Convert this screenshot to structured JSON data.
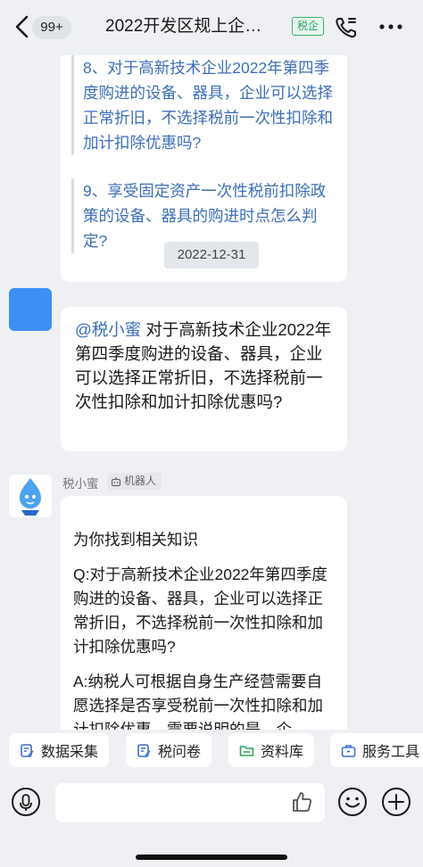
{
  "header": {
    "unread_badge": "99+",
    "title": "2022开发区规上企…",
    "tag": "税企"
  },
  "messages": {
    "card_questions": [
      "8、对于高新技术企业2022年第四季度购进的设备、器具，企业可以选择正常折旧，不选择税前一次性扣除和加计扣除优惠吗?",
      "9、享受固定资产一次性税前扣除政策的设备、器具的购进时点怎么判定?"
    ],
    "date_divider": "2022-12-31",
    "user_message": {
      "mention": "@税小蜜",
      "text": " 对于高新技术企业2022年第四季度购进的设备、器具，企业可以选择正常折旧，不选择税前一次性扣除和加计扣除优惠吗?"
    },
    "bot": {
      "name": "税小蜜",
      "robot_label": "机器人",
      "intro": "为你找到相关知识",
      "question": "Q:对于高新技术企业2022年第四季度购进的设备、器具，企业可以选择正常折旧，不选择税前一次性扣除和加计扣除优惠吗?",
      "answer": "A:纳税人可根据自身生产经营需要自愿选择是否享受税前一次性扣除和加计扣除优惠，需要说明的是，企"
    }
  },
  "quick_actions": [
    {
      "label": "数据采集",
      "icon": "form-edit-icon"
    },
    {
      "label": "税问卷",
      "icon": "questionnaire-icon"
    },
    {
      "label": "资料库",
      "icon": "folder-icon"
    },
    {
      "label": "服务工具",
      "icon": "toolbox-icon"
    }
  ],
  "colors": {
    "accent_link": "#3d6eb8",
    "tag_green": "#2ea35f",
    "avatar_blue": "#3e8ef7",
    "background": "#eef0f3"
  }
}
